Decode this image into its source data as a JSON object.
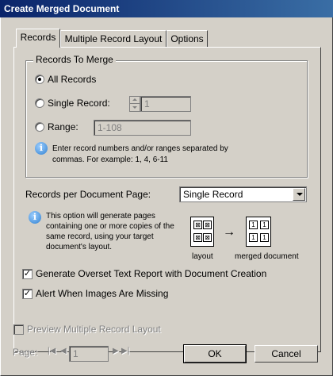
{
  "window": {
    "title": "Create Merged Document"
  },
  "tabs": [
    {
      "label": "Records",
      "active": true
    },
    {
      "label": "Multiple Record Layout",
      "active": false
    },
    {
      "label": "Options",
      "active": false
    }
  ],
  "records_to_merge": {
    "legend": "Records To Merge",
    "all_records_label": "All Records",
    "single_record_label": "Single Record:",
    "single_record_value": "1",
    "range_label": "Range:",
    "range_value": "1-108",
    "hint_line1": "Enter record numbers and/or ranges separated by",
    "hint_line2": "commas. For example: 1, 4, 6-11",
    "selected": "All Records"
  },
  "per_page": {
    "label": "Records per Document Page:",
    "value": "Single Record"
  },
  "info": {
    "line1": "This option will generate pages",
    "line2": "containing one or more copies of the",
    "line3": "same record, using your target",
    "line4": "document's layout."
  },
  "diagram": {
    "layout_caption": "layout",
    "merged_caption": "merged document",
    "merged_cell_text": "1"
  },
  "options": {
    "overset_label": "Generate Overset Text Report with Document Creation",
    "overset_checked": true,
    "alert_label": "Alert When Images Are Missing",
    "alert_checked": true
  },
  "footer": {
    "preview_label": "Preview Multiple Record Layout",
    "page_label": "Page:",
    "page_value": "1",
    "ok_label": "OK",
    "cancel_label": "Cancel"
  }
}
